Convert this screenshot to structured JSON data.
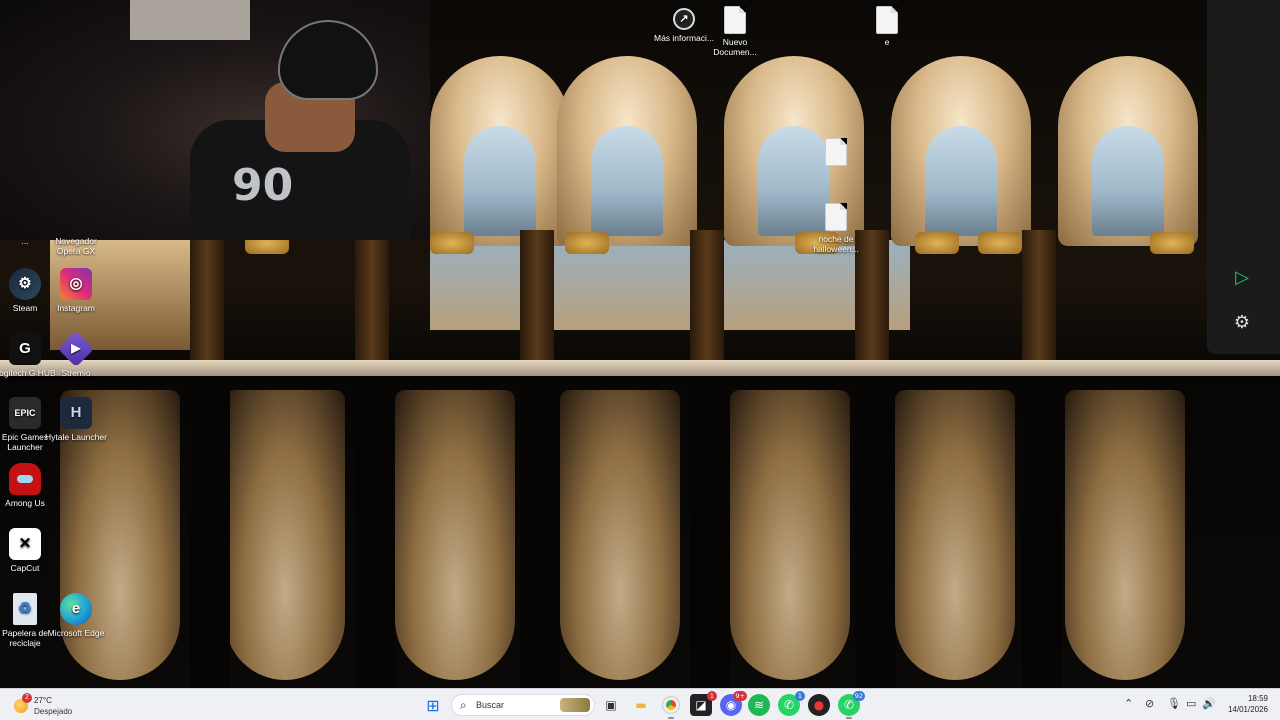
{
  "desktop_icons": {
    "steam": "Steam",
    "instagram": "Instagram",
    "logitech": "Logitech G HUB",
    "stremio": "Stremio",
    "epic": "Epic Games Launcher",
    "hytale": "Hytale Launcher",
    "among_us": "Among Us",
    "capcut": "CapCut",
    "recycle_bin": "Papelera de reciclaje",
    "edge": "Microsoft Edge",
    "mas_info": "Más informaci...",
    "nuevo_doc": "Nuevo Documen...",
    "e_doc": "e",
    "noche_halloween": "noche de halloween...",
    "partial_top_a": "...",
    "partial_top_b": "Navegador Opera GX"
  },
  "webcam": {
    "jersey_number": "90"
  },
  "taskbar": {
    "weather_temp": "27°C",
    "weather_cond": "Despejado",
    "weather_badge": "2",
    "search_placeholder": "Buscar",
    "badges": {
      "pinned1": "1",
      "discord": "9+",
      "whatsapp1": "1",
      "whatsapp2": "92"
    },
    "time": "18:59",
    "date": "14/01/2026"
  },
  "colors": {
    "taskbar_bg": "#eef0f4",
    "accent_green": "#22c55e",
    "badge_red": "#d13438"
  }
}
